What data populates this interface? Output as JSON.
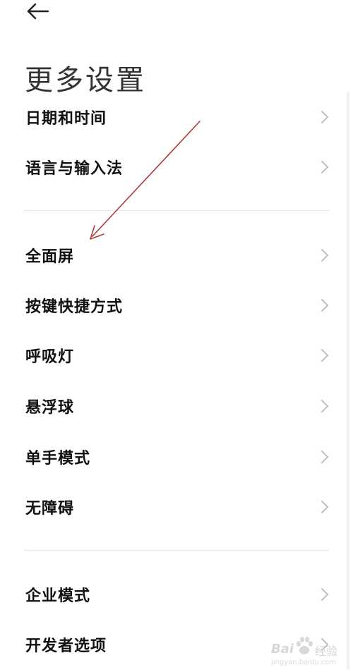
{
  "header": {
    "back_icon": "arrow-left-icon",
    "title": "更多设置"
  },
  "groups": [
    {
      "items": [
        {
          "label": "日期和时间",
          "icon": "chevron-right-icon"
        },
        {
          "label": "语言与输入法",
          "icon": "chevron-right-icon"
        }
      ]
    },
    {
      "items": [
        {
          "label": "全面屏",
          "icon": "chevron-right-icon"
        },
        {
          "label": "按键快捷方式",
          "icon": "chevron-right-icon"
        },
        {
          "label": "呼吸灯",
          "icon": "chevron-right-icon"
        },
        {
          "label": "悬浮球",
          "icon": "chevron-right-icon"
        },
        {
          "label": "单手模式",
          "icon": "chevron-right-icon"
        },
        {
          "label": "无障碍",
          "icon": "chevron-right-icon"
        }
      ]
    },
    {
      "items": [
        {
          "label": "企业模式",
          "icon": "chevron-right-icon"
        },
        {
          "label": "开发者选项",
          "icon": "chevron-right-icon"
        }
      ]
    }
  ],
  "annotation": {
    "type": "arrow",
    "color": "#b03a3a",
    "points_to": "全面屏"
  },
  "watermark": {
    "logo": "Bai  ",
    "suffix": "经验",
    "url": "jingyan.baidu.com"
  }
}
